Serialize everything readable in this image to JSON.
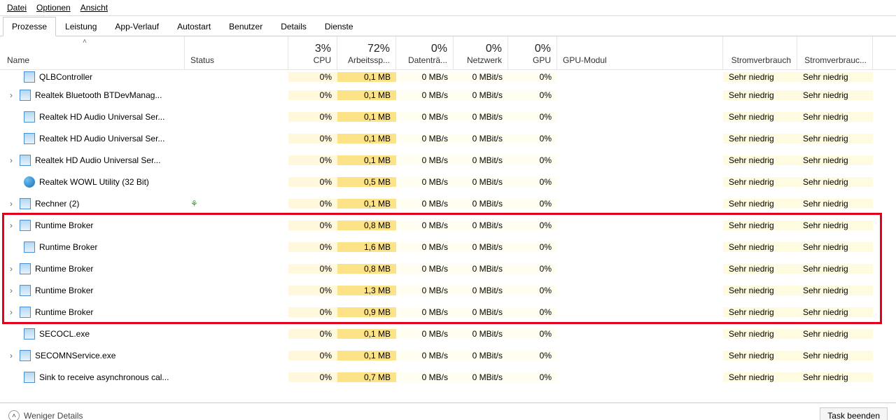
{
  "menu": {
    "file": "Datei",
    "options": "Optionen",
    "view": "Ansicht"
  },
  "tabs": [
    "Prozesse",
    "Leistung",
    "App-Verlauf",
    "Autostart",
    "Benutzer",
    "Details",
    "Dienste"
  ],
  "active_tab": 0,
  "columns": {
    "name": "Name",
    "status": "Status",
    "cpu": {
      "pct": "3%",
      "label": "CPU"
    },
    "mem": {
      "pct": "72%",
      "label": "Arbeitssp..."
    },
    "disk": {
      "pct": "0%",
      "label": "Datenträ..."
    },
    "net": {
      "pct": "0%",
      "label": "Netzwerk"
    },
    "gpu": {
      "pct": "0%",
      "label": "GPU"
    },
    "gpum": "GPU-Modul",
    "pw1": "Stromverbrauch",
    "pw2": "Stromverbrauc..."
  },
  "rows": [
    {
      "exp": false,
      "indent": 1,
      "icon": "app",
      "name": "QLBController",
      "cpu": "0%",
      "mem": "0,1 MB",
      "disk": "0 MB/s",
      "net": "0 MBit/s",
      "gpu": "0%",
      "pw1": "Sehr niedrig",
      "pw2": "Sehr niedrig",
      "status": "",
      "cut": true
    },
    {
      "exp": true,
      "indent": 0,
      "icon": "app",
      "name": "Realtek Bluetooth BTDevManag...",
      "cpu": "0%",
      "mem": "0,1 MB",
      "disk": "0 MB/s",
      "net": "0 MBit/s",
      "gpu": "0%",
      "pw1": "Sehr niedrig",
      "pw2": "Sehr niedrig",
      "status": ""
    },
    {
      "exp": false,
      "indent": 1,
      "icon": "app",
      "name": "Realtek HD Audio Universal Ser...",
      "cpu": "0%",
      "mem": "0,1 MB",
      "disk": "0 MB/s",
      "net": "0 MBit/s",
      "gpu": "0%",
      "pw1": "Sehr niedrig",
      "pw2": "Sehr niedrig",
      "status": ""
    },
    {
      "exp": false,
      "indent": 1,
      "icon": "app",
      "name": "Realtek HD Audio Universal Ser...",
      "cpu": "0%",
      "mem": "0,1 MB",
      "disk": "0 MB/s",
      "net": "0 MBit/s",
      "gpu": "0%",
      "pw1": "Sehr niedrig",
      "pw2": "Sehr niedrig",
      "status": ""
    },
    {
      "exp": true,
      "indent": 0,
      "icon": "app",
      "name": "Realtek HD Audio Universal Ser...",
      "cpu": "0%",
      "mem": "0,1 MB",
      "disk": "0 MB/s",
      "net": "0 MBit/s",
      "gpu": "0%",
      "pw1": "Sehr niedrig",
      "pw2": "Sehr niedrig",
      "status": ""
    },
    {
      "exp": false,
      "indent": 1,
      "icon": "globe",
      "name": "Realtek WOWL Utility (32 Bit)",
      "cpu": "0%",
      "mem": "0,5 MB",
      "disk": "0 MB/s",
      "net": "0 MBit/s",
      "gpu": "0%",
      "pw1": "Sehr niedrig",
      "pw2": "Sehr niedrig",
      "status": ""
    },
    {
      "exp": true,
      "indent": 0,
      "icon": "app",
      "name": "Rechner (2)",
      "cpu": "0%",
      "mem": "0,1 MB",
      "disk": "0 MB/s",
      "net": "0 MBit/s",
      "gpu": "0%",
      "pw1": "Sehr niedrig",
      "pw2": "Sehr niedrig",
      "status": "",
      "leaf": true
    },
    {
      "exp": true,
      "indent": 0,
      "icon": "app",
      "name": "Runtime Broker",
      "cpu": "0%",
      "mem": "0,8 MB",
      "disk": "0 MB/s",
      "net": "0 MBit/s",
      "gpu": "0%",
      "pw1": "Sehr niedrig",
      "pw2": "Sehr niedrig",
      "status": ""
    },
    {
      "exp": false,
      "indent": 1,
      "icon": "app",
      "name": "Runtime Broker",
      "cpu": "0%",
      "mem": "1,6 MB",
      "disk": "0 MB/s",
      "net": "0 MBit/s",
      "gpu": "0%",
      "pw1": "Sehr niedrig",
      "pw2": "Sehr niedrig",
      "status": ""
    },
    {
      "exp": true,
      "indent": 0,
      "icon": "app",
      "name": "Runtime Broker",
      "cpu": "0%",
      "mem": "0,8 MB",
      "disk": "0 MB/s",
      "net": "0 MBit/s",
      "gpu": "0%",
      "pw1": "Sehr niedrig",
      "pw2": "Sehr niedrig",
      "status": ""
    },
    {
      "exp": true,
      "indent": 0,
      "icon": "app",
      "name": "Runtime Broker",
      "cpu": "0%",
      "mem": "1,3 MB",
      "disk": "0 MB/s",
      "net": "0 MBit/s",
      "gpu": "0%",
      "pw1": "Sehr niedrig",
      "pw2": "Sehr niedrig",
      "status": ""
    },
    {
      "exp": true,
      "indent": 0,
      "icon": "app",
      "name": "Runtime Broker",
      "cpu": "0%",
      "mem": "0,9 MB",
      "disk": "0 MB/s",
      "net": "0 MBit/s",
      "gpu": "0%",
      "pw1": "Sehr niedrig",
      "pw2": "Sehr niedrig",
      "status": ""
    },
    {
      "exp": false,
      "indent": 1,
      "icon": "app",
      "name": "SECOCL.exe",
      "cpu": "0%",
      "mem": "0,1 MB",
      "disk": "0 MB/s",
      "net": "0 MBit/s",
      "gpu": "0%",
      "pw1": "Sehr niedrig",
      "pw2": "Sehr niedrig",
      "status": ""
    },
    {
      "exp": true,
      "indent": 0,
      "icon": "app",
      "name": "SECOMNService.exe",
      "cpu": "0%",
      "mem": "0,1 MB",
      "disk": "0 MB/s",
      "net": "0 MBit/s",
      "gpu": "0%",
      "pw1": "Sehr niedrig",
      "pw2": "Sehr niedrig",
      "status": ""
    },
    {
      "exp": false,
      "indent": 1,
      "icon": "app",
      "name": "Sink to receive asynchronous cal...",
      "cpu": "0%",
      "mem": "0,7 MB",
      "disk": "0 MB/s",
      "net": "0 MBit/s",
      "gpu": "0%",
      "pw1": "Sehr niedrig",
      "pw2": "Sehr niedrig",
      "status": ""
    }
  ],
  "highlight": {
    "from_row": 7,
    "to_row": 11
  },
  "footer": {
    "fewer": "Weniger Details",
    "endtask": "Task beenden"
  }
}
